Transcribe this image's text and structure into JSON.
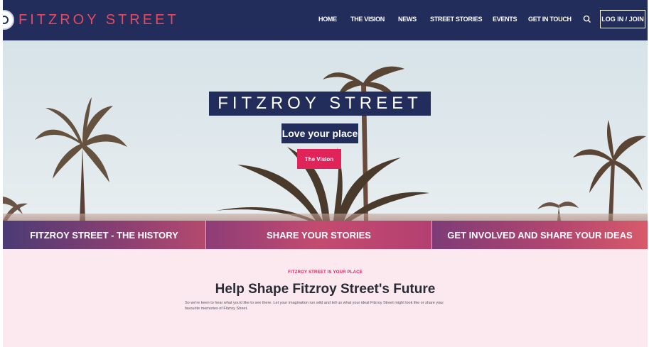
{
  "header": {
    "brand": "FITZROY STREET",
    "nav": [
      "HOME",
      "THE VISION",
      "NEWS",
      "STREET STORIES",
      "EVENTS",
      "GET IN TOUCH"
    ],
    "login_label": "LOG IN / JOIN",
    "search_icon": "search-icon"
  },
  "hero": {
    "title": "FITZROY STREET",
    "tagline": "Love your place",
    "button_label": "The Vision"
  },
  "cards": [
    {
      "label": "FITZROY STREET - THE HISTORY"
    },
    {
      "label": "SHARE YOUR STORIES"
    },
    {
      "label": "GET INVOLVED AND SHARE YOUR IDEAS"
    }
  ],
  "intro": {
    "eyebrow": "FITZROY STREET IS YOUR PLACE",
    "heading": "Help Shape Fitzroy Street's Future",
    "body": "So we're keen to hear what you'd like to see there. Let your imagination run wild and tell us what your ideal Fitzroy Street might look like or share your favourite memories of Fitzroy Street."
  },
  "colors": {
    "nav_bg": "#232d5c",
    "brand_accent": "#e54a5f",
    "cta_pink": "#e0245a",
    "page_bg": "#fbe9ef"
  }
}
